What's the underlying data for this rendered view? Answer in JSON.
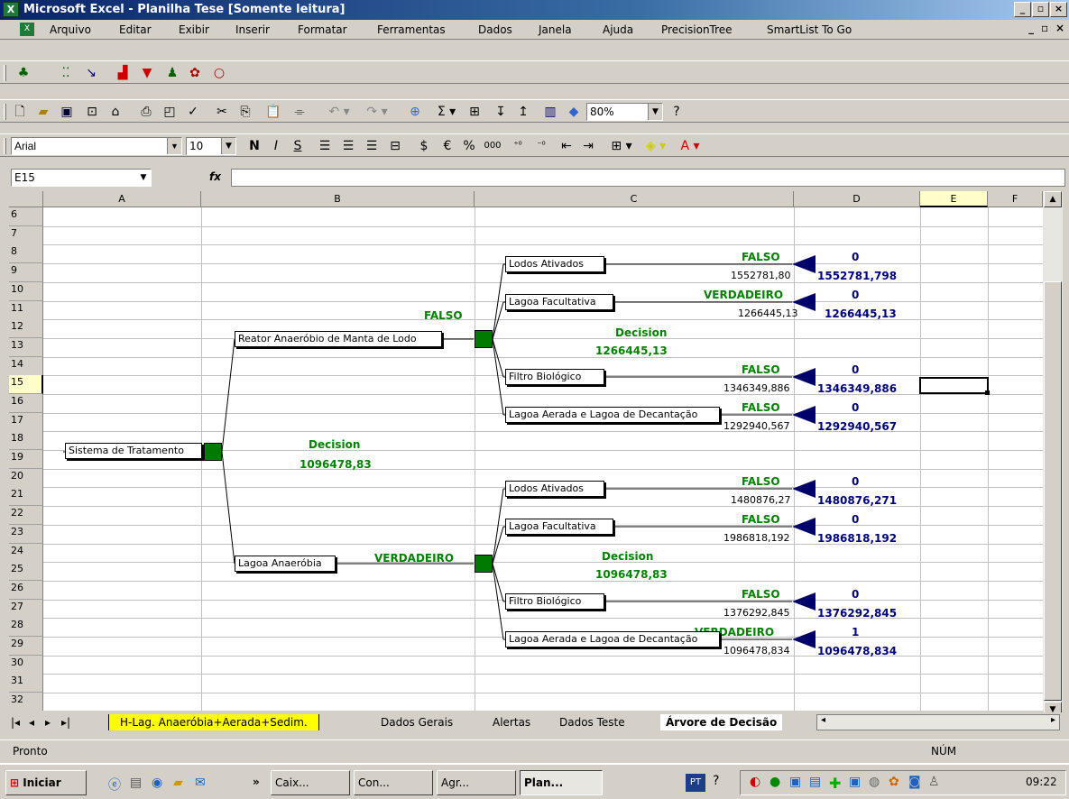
{
  "window": {
    "title": "Microsoft Excel - Planilha Tese  [Somente leitura]"
  },
  "menu": [
    "Arquivo",
    "Editar",
    "Exibir",
    "Inserir",
    "Formatar",
    "Ferramentas",
    "Dados",
    "Janela",
    "Ajuda",
    "PrecisionTree",
    "SmartList To Go"
  ],
  "toolbar": {
    "zoom": "80%",
    "font": "Arial",
    "font_size": "10"
  },
  "formula_bar": {
    "cell_ref": "E15",
    "fx": "fx",
    "value": ""
  },
  "columns": [
    "A",
    "B",
    "C",
    "D",
    "E",
    "F"
  ],
  "rows": [
    "6",
    "7",
    "8",
    "9",
    "10",
    "11",
    "12",
    "13",
    "14",
    "15",
    "16",
    "17",
    "18",
    "19",
    "20",
    "21",
    "22",
    "23",
    "24",
    "25",
    "26",
    "27",
    "28",
    "29",
    "30",
    "31",
    "32"
  ],
  "tree": {
    "root": {
      "label": "Sistema de Tratamento",
      "decision_label": "Decision",
      "decision_value": "1096478,83"
    },
    "branch1": {
      "label": "Reator Anaeróbio de Manta de Lodo",
      "flag": "FALSO",
      "decision_label": "Decision",
      "decision_value": "1266445,13"
    },
    "branch2": {
      "label": "Lagoa Anaeróbia",
      "flag": "VERDADEIRO",
      "decision_label": "Decision",
      "decision_value": "1096478,83"
    },
    "leaves": [
      {
        "label": "Lodos Ativados",
        "flag": "FALSO",
        "cost": "1552781,80",
        "prob": "0",
        "value": "1552781,798"
      },
      {
        "label": "Lagoa Facultativa",
        "flag": "VERDADEIRO",
        "cost": "1266445,13",
        "prob": "0",
        "value": "1266445,13"
      },
      {
        "label": "Filtro Biológico",
        "flag": "FALSO",
        "cost": "1346349,886",
        "prob": "0",
        "value": "1346349,886"
      },
      {
        "label": "Lagoa Aerada e Lagoa de Decantação",
        "flag": "FALSO",
        "cost": "1292940,567",
        "prob": "0",
        "value": "1292940,567"
      },
      {
        "label": "Lodos Ativados",
        "flag": "FALSO",
        "cost": "1480876,27",
        "prob": "0",
        "value": "1480876,271"
      },
      {
        "label": "Lagoa Facultativa",
        "flag": "FALSO",
        "cost": "1986818,192",
        "prob": "0",
        "value": "1986818,192"
      },
      {
        "label": "Filtro Biológico",
        "flag": "FALSO",
        "cost": "1376292,845",
        "prob": "0",
        "value": "1376292,845"
      },
      {
        "label": "Lagoa Aerada e Lagoa de Decantação",
        "flag": "VERDADEIRO",
        "cost": "1096478,834",
        "prob": "1",
        "value": "1096478,834"
      }
    ]
  },
  "sheet_tabs": [
    "H-Lag. Anaeróbia+Aerada+Sedim.",
    "Dados Gerais",
    "Alertas",
    "Dados Teste",
    "Árvore de Decisão"
  ],
  "status": {
    "left": "Pronto",
    "num": "NÚM"
  },
  "taskbar": {
    "start": "Iniciar",
    "items": [
      "Caix...",
      "Con...",
      "Agr...",
      "Plan..."
    ],
    "tray_pt": "PT",
    "clock": "09:22"
  },
  "colors": {
    "title_from": "#0a246a",
    "title_to": "#a6caf0",
    "decision_green": "#008000",
    "value_blue": "#00007a",
    "node_square": "#007a00",
    "active_tab": "#ffff00"
  }
}
